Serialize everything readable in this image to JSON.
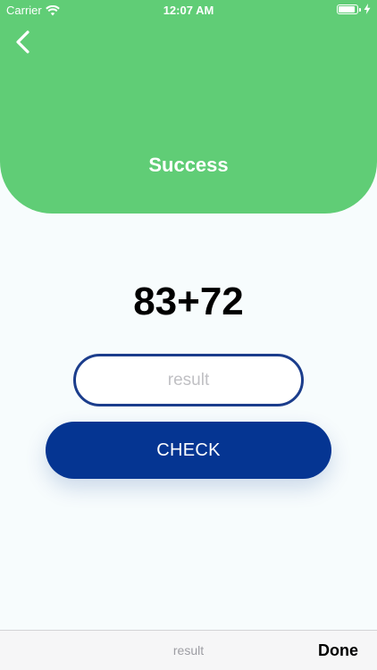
{
  "status_bar": {
    "carrier": "Carrier",
    "time": "12:07 AM",
    "wifi_icon": "wifi-icon",
    "battery_icon": "battery-icon",
    "charging_icon": "bolt-icon"
  },
  "header": {
    "title": "Success",
    "back_icon": "chevron-left-icon",
    "background_color": "#60cd76"
  },
  "main": {
    "problem": "83+72",
    "result_input": {
      "value": "",
      "placeholder": "result"
    },
    "check_button": {
      "label": "CHECK",
      "color": "#053592"
    }
  },
  "keyboard_toolbar": {
    "placeholder": "result",
    "done_label": "Done"
  }
}
